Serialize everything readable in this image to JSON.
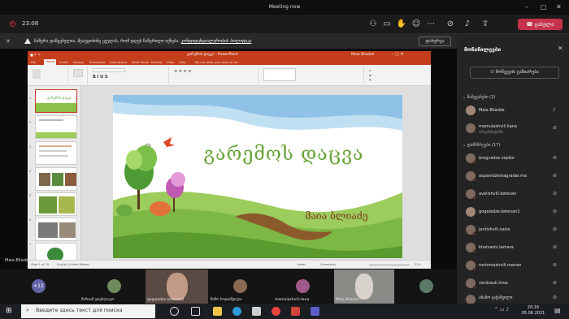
{
  "window": {
    "title": "Meeting now"
  },
  "controls": {
    "timer": "23:08",
    "leave_label": "გასვლა"
  },
  "notice": {
    "text": "ჩაწერა დაწყებულია.  შეატყობინე ყველას, რომ დღეს ჩაწერილი იქნება. ",
    "link_text": "კონფიდენციალურობის პოლიტიკა",
    "button_label": "დახურვა"
  },
  "powerpoint": {
    "title": "გარემოს დაცვა - PowerPoint",
    "user": "Maia Bliadze",
    "tabs": [
      "File",
      "Home",
      "Insert",
      "Design",
      "Transitions",
      "Animations",
      "Slide Show",
      "Review",
      "View",
      "Help",
      "Tell me what you want to do"
    ],
    "status_slide": "Slide 1 of 19",
    "status_lang": "English (United States)",
    "status_notes": "Notes",
    "status_comments": "Comments",
    "status_zoom": "31%",
    "thumb_numbers": [
      "1",
      "2",
      "3",
      "4",
      "5",
      "6",
      "7"
    ]
  },
  "slide": {
    "title": "გარემოს დაცვა",
    "author": "მაია ბლიაძე"
  },
  "speaker_label": "Maia Bliadze",
  "panel": {
    "header": "მონაწილეები",
    "share_label": "მოწვევის გაზიარება",
    "presenters_section": "წამყვანები (2)",
    "attendees_section": "დამსწრეები (17)",
    "presenters": [
      {
        "name": "Maia Bliadze",
        "sub": ""
      },
      {
        "name": "mamulashvili.liana",
        "sub": "ორგანიზატორი"
      }
    ],
    "attendees": [
      {
        "name": "bregvadze.sopiko"
      },
      {
        "name": "aspanidzemagradar.ma"
      },
      {
        "name": "avalishvili.ketevan"
      },
      {
        "name": "gogaladze.ketevan2"
      },
      {
        "name": "jantishvili.naira"
      },
      {
        "name": "khalvashi.lamara"
      },
      {
        "name": "rostomashvili.manan"
      },
      {
        "name": "verdzauli.irma"
      },
      {
        "name": "ანანო ჯაჭაშვილი"
      }
    ]
  },
  "strip": {
    "plus_count": "+12",
    "tiles": [
      {
        "name": "მარიამ ეოგხლიკო"
      },
      {
        "name": "gogaladze.ketevan2"
      },
      {
        "name": "ნინო ხოჯაიშვილი"
      },
      {
        "name": "mamulashvili.liana"
      },
      {
        "name": "Maia Bliadze"
      }
    ]
  },
  "taskbar": {
    "search_placeholder": "Введите здесь текст для поиска",
    "time": "20:16",
    "date": "05.06.2021"
  },
  "colors": {
    "leave": "#c4314b",
    "ppt_accent": "#c43e1c",
    "teams_purple": "#6264a7"
  }
}
